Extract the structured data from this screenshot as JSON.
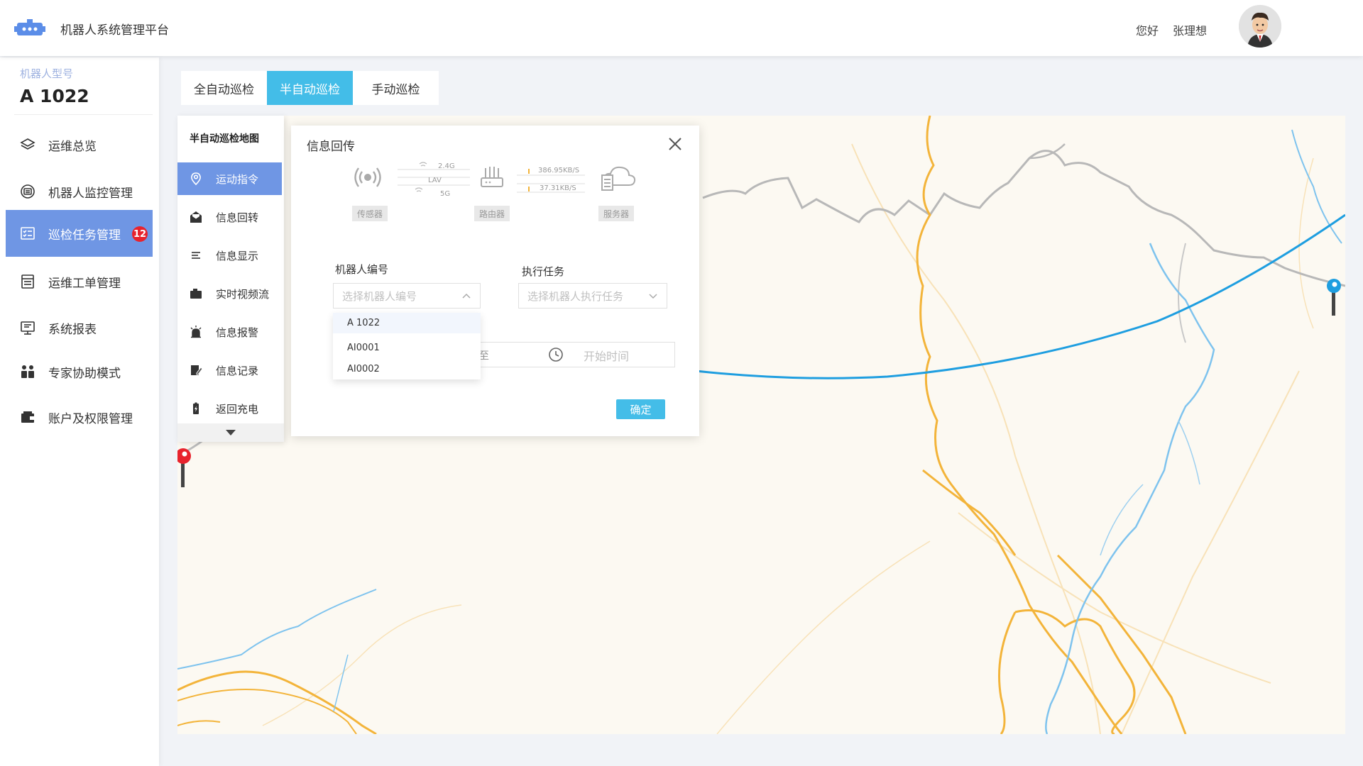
{
  "header": {
    "title": "机器人系统管理平台",
    "greeting": "您好",
    "username": "张理想",
    "logo_icon": "robot-icon",
    "avatar_icon": "user-avatar"
  },
  "sidebar": {
    "model_label": "机器人型号",
    "model_value": "A 1022",
    "items": [
      {
        "label": "运维总览",
        "icon": "layers-icon"
      },
      {
        "label": "机器人监控管理",
        "icon": "monitor-icon"
      },
      {
        "label": "巡检任务管理",
        "icon": "task-list-icon",
        "badge": "12",
        "active": true
      },
      {
        "label": "运维工单管理",
        "icon": "work-order-icon"
      },
      {
        "label": "系统报表",
        "icon": "report-icon"
      },
      {
        "label": "专家协助模式",
        "icon": "expert-icon"
      },
      {
        "label": "账户及权限管理",
        "icon": "wallet-icon"
      }
    ]
  },
  "tabs": [
    {
      "label": "全自动巡检",
      "active": false
    },
    {
      "label": "半自动巡检",
      "active": true
    },
    {
      "label": "手动巡检",
      "active": false
    }
  ],
  "map_panel": {
    "title": "半自动巡检地图",
    "items": [
      {
        "label": "运动指令",
        "icon": "location-pin-icon",
        "active": true
      },
      {
        "label": "信息回转",
        "icon": "mail-open-icon"
      },
      {
        "label": "信息显示",
        "icon": "text-lines-icon"
      },
      {
        "label": "实时视频流",
        "icon": "camera-icon"
      },
      {
        "label": "信息报警",
        "icon": "alarm-icon"
      },
      {
        "label": "信息记录",
        "icon": "edit-record-icon"
      },
      {
        "label": "返回充电",
        "icon": "battery-icon"
      }
    ]
  },
  "dialog": {
    "title": "信息回传",
    "network": {
      "sensor_label": "传感器",
      "router_label": "路由器",
      "server_label": "服务器",
      "band_24": "2.4G",
      "band_lav": "LAV",
      "band_5": "5G",
      "upload_speed": "386.95KB/S",
      "download_speed": "37.31KB/S"
    },
    "robot_id_label": "机器人编号",
    "robot_id_placeholder": "选择机器人编号",
    "task_label": "执行任务",
    "task_placeholder": "选择机器人执行任务",
    "time_separator": "至",
    "time_placeholder": "开始时间",
    "confirm_label": "确定",
    "dropdown_options": [
      "A 1022",
      "AI0001",
      "AI0002"
    ]
  },
  "colors": {
    "primary": "#6f96e4",
    "accent": "#43bde8",
    "badge": "#e8232d",
    "route": "#1e9ee0",
    "road": "#f3b43a",
    "river": "#7ec3ee"
  }
}
